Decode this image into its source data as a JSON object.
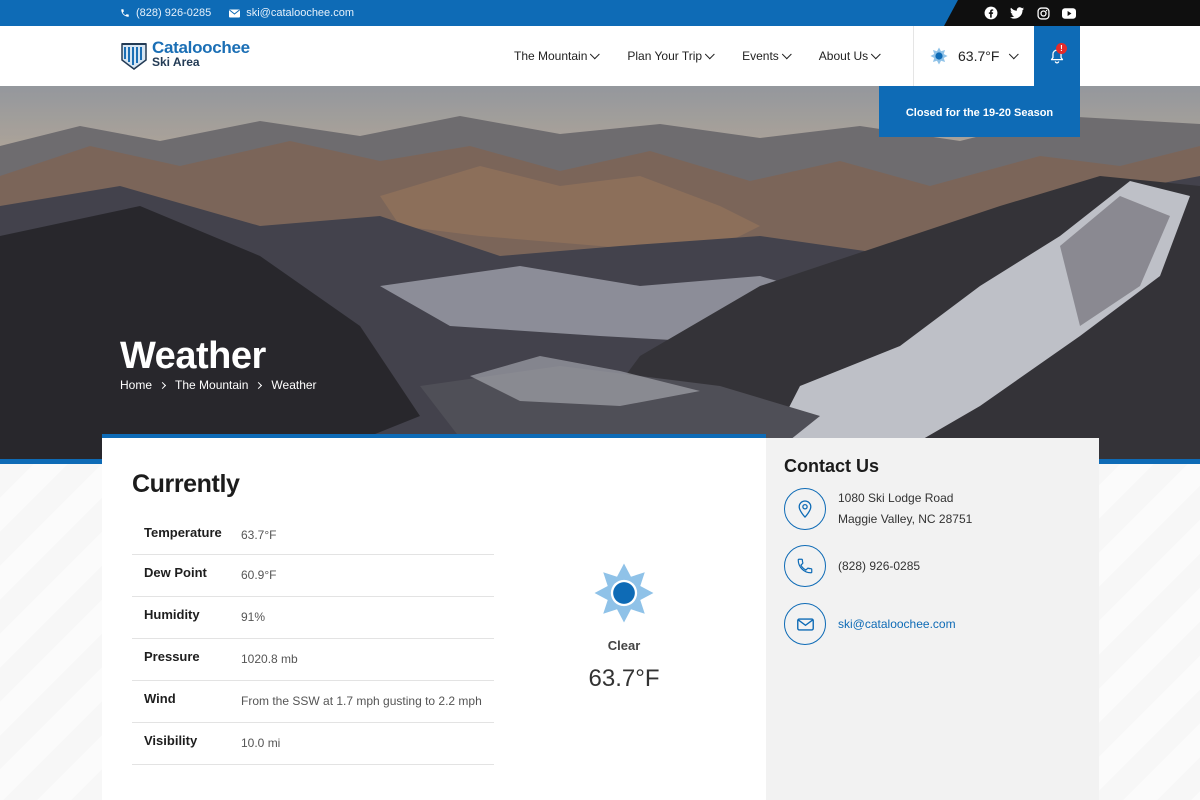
{
  "topbar": {
    "phone": "(828) 926-0285",
    "email": "ski@cataloochee.com",
    "social_icons": [
      "facebook-icon",
      "twitter-icon",
      "instagram-icon",
      "youtube-icon"
    ]
  },
  "header": {
    "logo_line1": "Cataloochee",
    "logo_line2": "Ski Area",
    "nav": [
      {
        "label": "The Mountain"
      },
      {
        "label": "Plan Your Trip"
      },
      {
        "label": "Events"
      },
      {
        "label": "About Us"
      }
    ],
    "weather_temp": "63.7°F",
    "alert_badge": "!"
  },
  "hero": {
    "banner": "Closed for the 19-20 Season",
    "title": "Weather",
    "breadcrumb": [
      "Home",
      "The Mountain",
      "Weather"
    ]
  },
  "currently": {
    "heading": "Currently",
    "rows": [
      {
        "label": "Temperature",
        "value": "63.7°F"
      },
      {
        "label": "Dew Point",
        "value": "60.9°F"
      },
      {
        "label": "Humidity",
        "value": "91%"
      },
      {
        "label": "Pressure",
        "value": "1020.8 mb"
      },
      {
        "label": "Wind",
        "value": "From the SSW at 1.7 mph gusting to 2.2 mph"
      },
      {
        "label": "Visibility",
        "value": "10.0 mi"
      }
    ],
    "condition": "Clear",
    "temp": "63.7°F"
  },
  "contact": {
    "heading": "Contact Us",
    "address_line1": "1080 Ski Lodge Road",
    "address_line2": "Maggie Valley, NC 28751",
    "phone": "(828) 926-0285",
    "email": "ski@cataloochee.com"
  },
  "colors": {
    "brand_blue": "#0e6bb6",
    "alert_red": "#e32b2b",
    "sun_light": "#8fc2e8"
  }
}
